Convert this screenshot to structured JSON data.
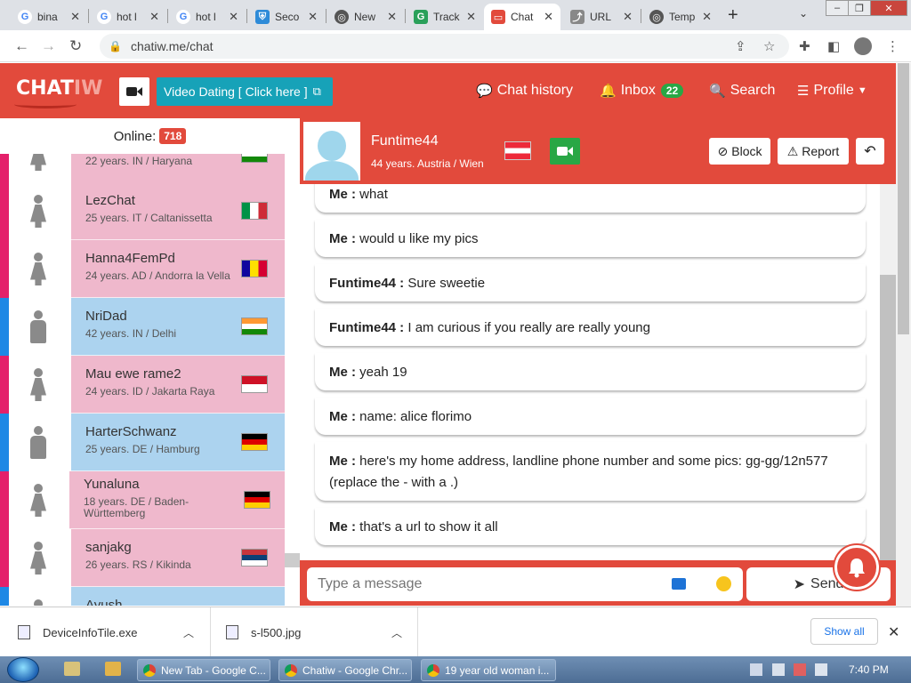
{
  "browser": {
    "tabs": [
      {
        "label": "bina",
        "favicon": "google",
        "color": "#4285f4"
      },
      {
        "label": "hot l",
        "favicon": "google",
        "color": "#4285f4"
      },
      {
        "label": "hot l",
        "favicon": "google",
        "color": "#4285f4"
      },
      {
        "label": "Seco",
        "favicon": "shield",
        "color": "#2e8bd8"
      },
      {
        "label": "New",
        "favicon": "globe",
        "color": "#555555"
      },
      {
        "label": "Track",
        "favicon": "tracker",
        "color": "#2aa05a"
      },
      {
        "label": "Chat",
        "favicon": "chat",
        "color": "#e24a3c",
        "active": true
      },
      {
        "label": "URL",
        "favicon": "link",
        "color": "#888888"
      },
      {
        "label": "Temp",
        "favicon": "globe",
        "color": "#555555"
      }
    ],
    "new_tab": "+",
    "url": "chatiw.me/chat"
  },
  "site": {
    "logo_main": "CHAT",
    "logo_tail": "IW",
    "video_dating_label": "Video Dating [ Click here ]",
    "nav": {
      "chat_history": "Chat history",
      "inbox": "Inbox",
      "inbox_count": "22",
      "search": "Search",
      "profile": "Profile"
    },
    "accent": "#e24a3c"
  },
  "online": {
    "label": "Online:",
    "count": "718"
  },
  "users": [
    {
      "name": "",
      "info": "22 years. IN / Haryana",
      "gender": "female",
      "flag": "india",
      "bg": "#efb8cc",
      "strip": "#e4206a"
    },
    {
      "name": "LezChat",
      "info": "25 years. IT / Caltanissetta",
      "gender": "female",
      "flag": "italy",
      "bg": "#efb8cc",
      "strip": "#e4206a"
    },
    {
      "name": "Hanna4FemPd",
      "info": "24 years. AD / Andorra la Vella",
      "gender": "female",
      "flag": "andorra",
      "bg": "#efb8cc",
      "strip": "#e4206a"
    },
    {
      "name": "NriDad",
      "info": "42 years. IN / Delhi",
      "gender": "male",
      "flag": "india",
      "bg": "#acd3ef",
      "strip": "#1e88e5"
    },
    {
      "name": "Mau ewe rame2",
      "info": "24 years. ID / Jakarta Raya",
      "gender": "female",
      "flag": "indonesia",
      "bg": "#efb8cc",
      "strip": "#e4206a"
    },
    {
      "name": "HarterSchwanz",
      "info": "25 years. DE / Hamburg",
      "gender": "male",
      "flag": "germany",
      "bg": "#acd3ef",
      "strip": "#1e88e5"
    },
    {
      "name": "Yunaluna",
      "info": "18 years. DE / Baden-Württemberg",
      "gender": "female",
      "flag": "germany",
      "bg": "#efb8cc",
      "strip": "#e4206a"
    },
    {
      "name": "sanjakg",
      "info": "26 years. RS / Kikinda",
      "gender": "female",
      "flag": "serbia",
      "bg": "#efb8cc",
      "strip": "#e4206a"
    },
    {
      "name": "Ayush",
      "info": "",
      "gender": "male",
      "flag": "",
      "bg": "#acd3ef",
      "strip": "#1e88e5"
    }
  ],
  "chat": {
    "partner_name": "Funtime44",
    "partner_info": "44 years. Austria / Wien",
    "block_label": "Block",
    "report_label": "Report",
    "messages": [
      {
        "sender": "Me :",
        "text": "what"
      },
      {
        "sender": "Me :",
        "text": "would u like my pics"
      },
      {
        "sender": "Funtime44 :",
        "text": "Sure sweetie"
      },
      {
        "sender": "Funtime44 :",
        "text": "I am curious if you really are really young"
      },
      {
        "sender": "Me :",
        "text": "yeah 19"
      },
      {
        "sender": "Me :",
        "text": "name: alice florimo"
      },
      {
        "sender": "Me :",
        "text": "here's my home address, landline phone number and some pics: gg-gg/12n577 (replace the - with a .)"
      },
      {
        "sender": "Me :",
        "text": "that's a url to show it all"
      }
    ],
    "input_placeholder": "Type a message",
    "send_label": "Send"
  },
  "downloads": {
    "items": [
      {
        "name": "DeviceInfoTile.exe"
      },
      {
        "name": "s-l500.jpg"
      }
    ],
    "show_all": "Show all"
  },
  "taskbar": {
    "buttons": [
      {
        "label": "New Tab - Google C..."
      },
      {
        "label": "Chatiw - Google Chr..."
      },
      {
        "label": "19 year old woman i..."
      }
    ],
    "time": "7:40 PM"
  }
}
